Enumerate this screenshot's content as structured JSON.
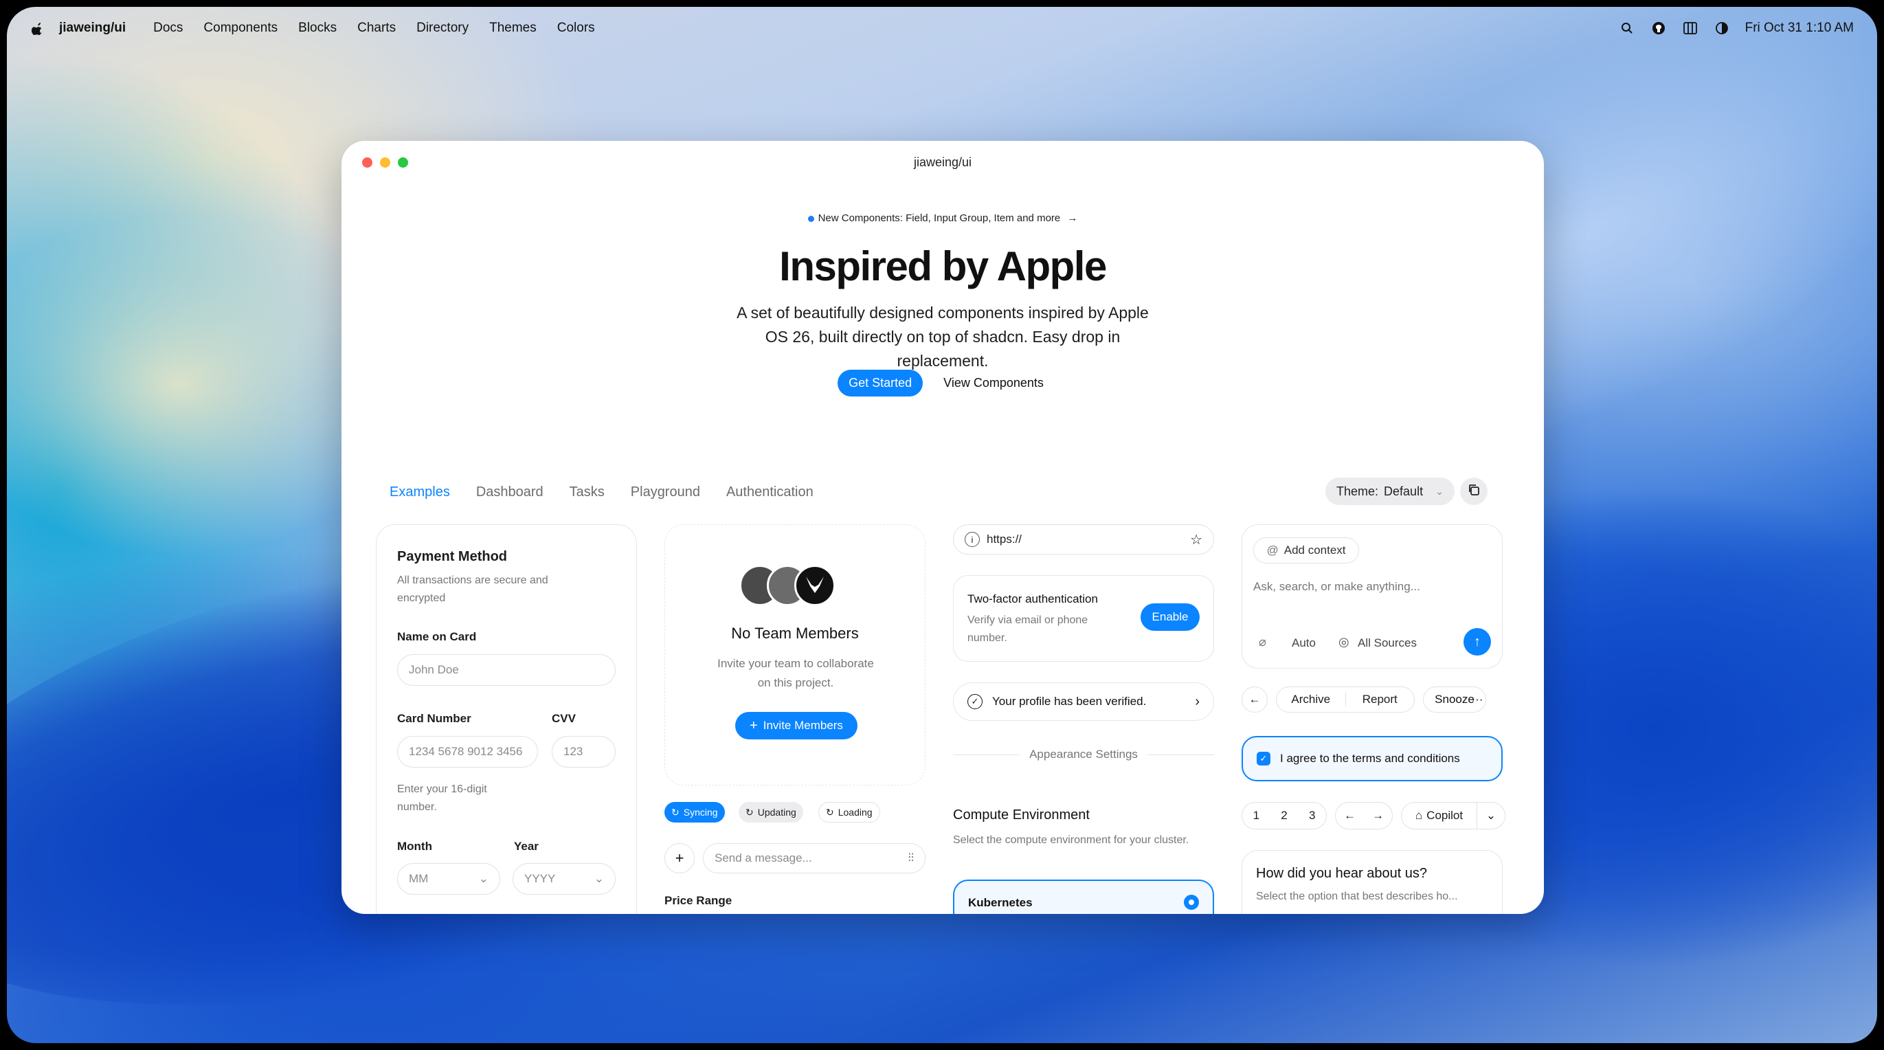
{
  "menubar": {
    "brand": "jiaweing/ui",
    "items": [
      "Docs",
      "Components",
      "Blocks",
      "Charts",
      "Directory",
      "Themes",
      "Colors"
    ],
    "datetime": "Fri Oct 31 1:10 AM"
  },
  "window": {
    "title": "jiaweing/ui",
    "announcement": "New Components: Field, Input Group, Item and more",
    "hero_title": "Inspired by Apple",
    "hero_subtitle": "A set of beautifully designed components inspired by Apple OS 26, built directly on top of shadcn. Easy drop in replacement.",
    "get_started": "Get Started",
    "view_components": "View Components"
  },
  "tabs": [
    "Examples",
    "Dashboard",
    "Tasks",
    "Playground",
    "Authentication"
  ],
  "theme": {
    "label": "Theme:",
    "value": "Default"
  },
  "payment": {
    "title": "Payment Method",
    "subtitle": "All transactions are secure and encrypted",
    "name_label": "Name on Card",
    "name_placeholder": "John Doe",
    "card_label": "Card Number",
    "card_placeholder": "1234 5678 9012 3456",
    "cvv_label": "CVV",
    "cvv_placeholder": "123",
    "card_help": "Enter your 16-digit number.",
    "month_label": "Month",
    "month_placeholder": "MM",
    "year_label": "Year",
    "year_placeholder": "YYYY"
  },
  "team": {
    "title": "No Team Members",
    "description": "Invite your team to collaborate on this project.",
    "invite": "Invite Members"
  },
  "status": {
    "syncing": "Syncing",
    "updating": "Updating",
    "loading": "Loading"
  },
  "message": {
    "placeholder": "Send a message..."
  },
  "price": {
    "label": "Price Range"
  },
  "url": {
    "value": "https://"
  },
  "twofa": {
    "title": "Two-factor authentication",
    "description": "Verify via email or phone number.",
    "enable": "Enable"
  },
  "verified": {
    "text": "Your profile has been verified."
  },
  "appearance": {
    "label": "Appearance Settings"
  },
  "compute": {
    "title": "Compute Environment",
    "description": "Select the compute environment for your cluster.",
    "option": "Kubernetes"
  },
  "ai": {
    "add_context": "Add context",
    "placeholder": "Ask, search, or make anything...",
    "auto": "Auto",
    "sources": "All Sources"
  },
  "actions": {
    "archive": "Archive",
    "report": "Report",
    "snooze": "Snooze"
  },
  "terms": {
    "text": "I agree to the terms and conditions"
  },
  "pagination": {
    "pages": [
      "1",
      "2",
      "3"
    ],
    "copilot": "Copilot"
  },
  "survey": {
    "title": "How did you hear about us?",
    "description": "Select the option that best describes ho..."
  },
  "colors": {
    "accent": "#0a84ff",
    "close": "#ff5f57",
    "minimize": "#febc2e",
    "zoom": "#28c840"
  }
}
